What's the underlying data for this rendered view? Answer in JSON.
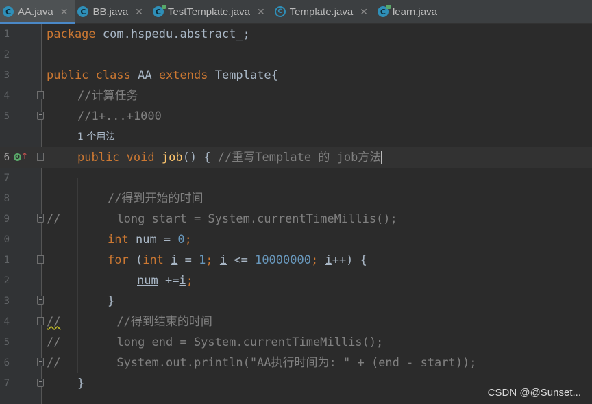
{
  "tabs": [
    {
      "label": "AA.java",
      "icon": "java-class-icon",
      "active": true
    },
    {
      "label": "BB.java",
      "icon": "java-class-icon"
    },
    {
      "label": "TestTemplate.java",
      "icon": "java-class-icon"
    },
    {
      "label": "Template.java",
      "icon": "java-abstract-class-icon"
    },
    {
      "label": "learn.java",
      "icon": "java-class-icon"
    }
  ],
  "close_glyph": "✕",
  "line_numbers": [
    "1",
    "2",
    "3",
    "4",
    "5",
    "",
    "6",
    "7",
    "8",
    "9",
    "0",
    "1",
    "2",
    "3",
    "4",
    "5",
    "6",
    "7"
  ],
  "code": {
    "l1_kw": "package",
    "l1_rest": " com.hspedu.abstract_;",
    "l3_kw1": "public",
    "l3_kw2": "class",
    "l3_name": " AA ",
    "l3_kw3": "extends",
    "l3_rest": " Template{",
    "l4": "//计算任务",
    "l5": "//1+...+1000",
    "hint": "1 个用法",
    "l6_kw1": "public",
    "l6_kw2": "void",
    "l6_fn": "job",
    "l6_rest": "() { ",
    "l6_comment": "//重写Template 的 job方法",
    "l8": "//得到开始的时间",
    "l9_prefix": "//",
    "l9_rest": "        long start = System.currentTimeMillis();",
    "l10_kw": "int",
    "l10_var": "num",
    "l10_eq": " = ",
    "l10_num": "0",
    "l10_semi": ";",
    "l11_kw1": "for",
    "l11_p1": " (",
    "l11_kw2": "int",
    "l11_i1": "i",
    "l11_eq": " = ",
    "l11_n1": "1",
    "l11_semi1": "; ",
    "l11_i2": "i",
    "l11_le": " <= ",
    "l11_n2": "10000000",
    "l11_semi2": "; ",
    "l11_i3": "i",
    "l11_end": "++) {",
    "l12_var": "num",
    "l12_op": " +=",
    "l12_i": "i",
    "l12_semi": ";",
    "l13": "}",
    "l14_prefix": "//",
    "l14_rest": "        //得到结束的时间",
    "l15_prefix": "//",
    "l15_rest": "        long end = System.currentTimeMillis();",
    "l16_prefix": "//",
    "l16_rest": "        System.out.println(\"AA执行时间为: \" + (end - start));",
    "l17": "}"
  },
  "gutter_icons": {
    "override": "override-icon",
    "arrow": "up-arrow-icon"
  },
  "watermark": "CSDN @@Sunset..."
}
